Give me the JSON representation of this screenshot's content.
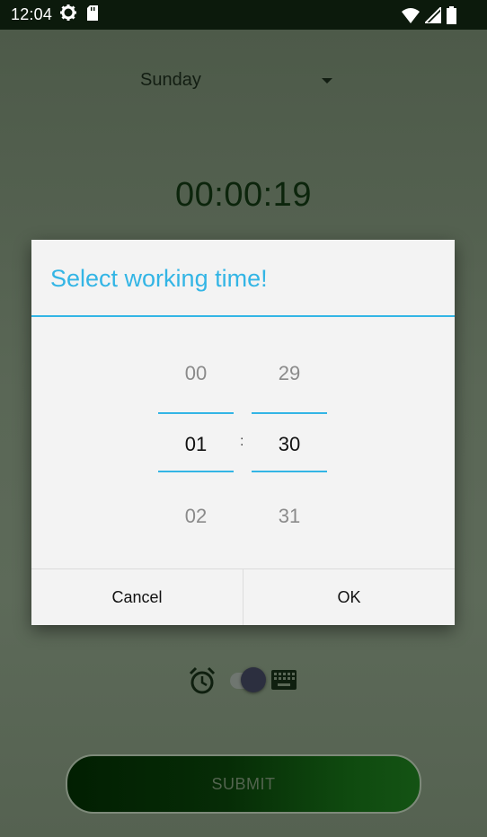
{
  "status_bar": {
    "time": "12:04",
    "icons": [
      "settings-gear-icon",
      "sd-card-icon",
      "wifi-icon",
      "cell-signal-icon",
      "battery-icon"
    ]
  },
  "main": {
    "day_select": {
      "value": "Sunday"
    },
    "timer": "00:00:19",
    "mode_toggle": {
      "left_icon": "alarm-icon",
      "right_icon": "keyboard-icon",
      "state": "right"
    },
    "submit_label": "SUBMIT"
  },
  "dialog": {
    "title": "Select working time!",
    "hours": {
      "prev": "00",
      "selected": "01",
      "next": "02"
    },
    "separator": ":",
    "minutes": {
      "prev": "29",
      "selected": "30",
      "next": "31"
    },
    "cancel_label": "Cancel",
    "ok_label": "OK"
  },
  "colors": {
    "accent": "#33b5e5",
    "status_bar_bg": "#0c1a0c",
    "app_bg": "#5a6756",
    "timer_text": "#0c250c",
    "submit_gradient_start": "#021f02",
    "submit_gradient_end": "#145314"
  }
}
